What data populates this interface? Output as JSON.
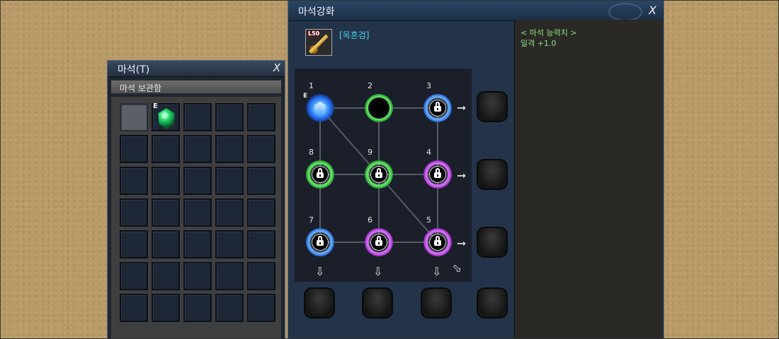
{
  "inventory": {
    "title": "마석(T)",
    "close": "X",
    "tab_label": "마석 보관함",
    "equip_badge": "E",
    "slots_visible": 35
  },
  "enhance": {
    "title": "마석강화",
    "close": "X",
    "item": {
      "level": "L50",
      "name": "[목혼검]"
    },
    "nodes": [
      {
        "label": "1",
        "color": "blue",
        "state": "equipped",
        "badge": "E"
      },
      {
        "label": "2",
        "color": "green",
        "state": "empty"
      },
      {
        "label": "3",
        "color": "blue",
        "state": "locked"
      },
      {
        "label": "8",
        "color": "green",
        "state": "locked"
      },
      {
        "label": "9",
        "color": "green",
        "state": "locked"
      },
      {
        "label": "4",
        "color": "purple",
        "state": "locked"
      },
      {
        "label": "7",
        "color": "blue",
        "state": "locked"
      },
      {
        "label": "6",
        "color": "purple",
        "state": "locked"
      },
      {
        "label": "5",
        "color": "purple",
        "state": "locked"
      }
    ],
    "stats": {
      "header": "< 마석 능력치 >",
      "value": "일격 +1.0"
    }
  },
  "colors": {
    "item_name": "#45d6e6",
    "stat_text": "#8ee07d",
    "blue": "#1b58c9",
    "green": "#1c8f2c",
    "purple": "#8a1fb3"
  }
}
